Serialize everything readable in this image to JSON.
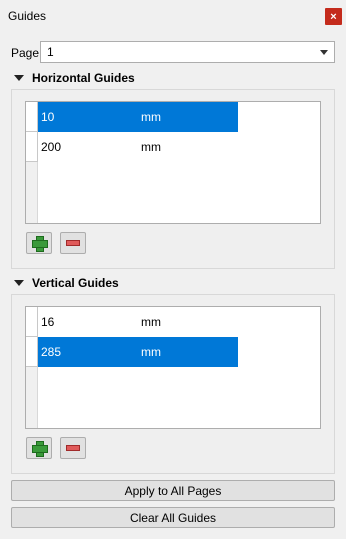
{
  "window": {
    "title": "Guides",
    "close_glyph": "×"
  },
  "page": {
    "label": "Page",
    "selected": "1"
  },
  "horizontal": {
    "header": "Horizontal Guides",
    "rows": [
      {
        "value": "10",
        "unit": "mm",
        "selected": true
      },
      {
        "value": "200",
        "unit": "mm",
        "selected": false
      }
    ]
  },
  "vertical": {
    "header": "Vertical Guides",
    "rows": [
      {
        "value": "16",
        "unit": "mm",
        "selected": false
      },
      {
        "value": "285",
        "unit": "mm",
        "selected": true
      }
    ]
  },
  "actions": {
    "apply_all": "Apply to All Pages",
    "clear_all": "Clear All Guides"
  },
  "colors": {
    "selection": "#0078d7",
    "close": "#c42b1c",
    "add": "#3a9a3a",
    "remove": "#e05a5a"
  },
  "icons": {
    "add": "add-icon",
    "remove": "remove-icon",
    "collapse": "collapse-triangle-icon"
  }
}
